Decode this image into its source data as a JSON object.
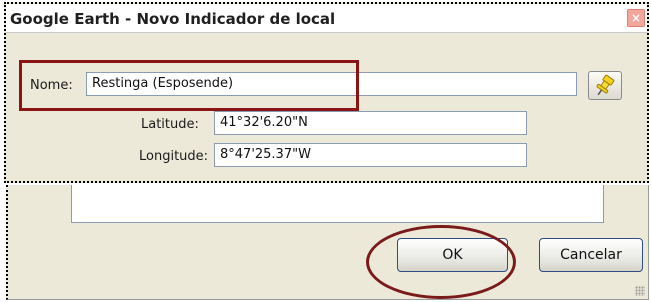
{
  "dialog": {
    "title": "Google Earth - Novo Indicador de local",
    "close_glyph": "×"
  },
  "fields": {
    "name_label": "Nome:",
    "name_value": "Restinga (Esposende)",
    "latitude_label": "Latitude:",
    "latitude_value": "41°32'6.20\"N",
    "longitude_label": "Longitude:",
    "longitude_value": "8°47'25.37\"W"
  },
  "icons": {
    "pin": "pushpin-icon",
    "close": "close-icon"
  },
  "buttons": {
    "ok_label": "OK",
    "cancel_label": "Cancelar"
  },
  "colors": {
    "dialog_bg": "#ece9d8",
    "annotation": "#8b1414",
    "pin_yellow": "#f2d21c"
  }
}
